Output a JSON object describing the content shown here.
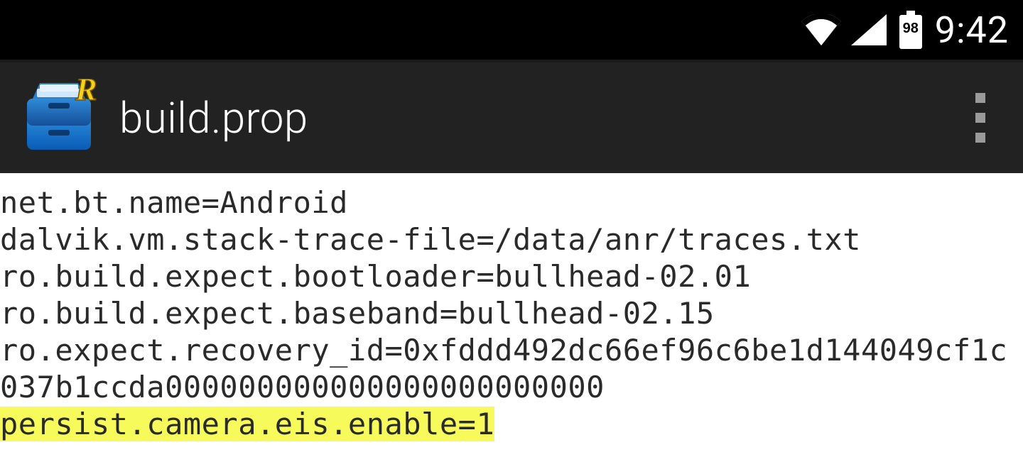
{
  "status": {
    "battery_level": "98",
    "clock": "9:42"
  },
  "appbar": {
    "title": "build.prop"
  },
  "file": {
    "lines": [
      "net.bt.name=Android",
      "dalvik.vm.stack-trace-file=/data/anr/traces.txt",
      "ro.build.expect.bootloader=bullhead-02.01",
      "ro.build.expect.baseband=bullhead-02.15",
      "ro.expect.recovery_id=0xfddd492dc66ef96c6be1d144049cf1c037b1ccda000000000000000000000000"
    ],
    "highlighted": "persist.camera.eis.enable=1"
  },
  "colors": {
    "highlight": "#f6fb5b",
    "statusbar": "#000000",
    "appbar": "#222222"
  }
}
